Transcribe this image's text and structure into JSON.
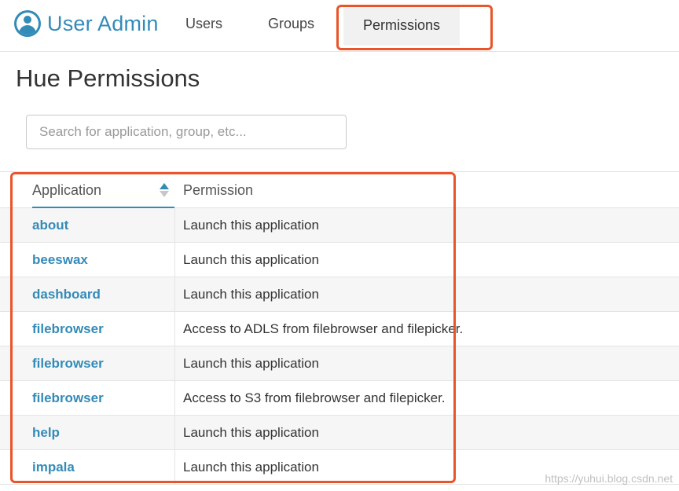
{
  "header": {
    "brand": "User Admin",
    "brand_icon": "user-circle-icon",
    "nav": [
      {
        "label": "Users",
        "active": false
      },
      {
        "label": "Groups",
        "active": false
      },
      {
        "label": "Permissions",
        "active": true
      }
    ]
  },
  "page_title": "Hue Permissions",
  "search": {
    "placeholder": "Search for application, group, etc...",
    "value": ""
  },
  "table": {
    "columns": [
      "Application",
      "Permission"
    ],
    "sort": {
      "column": "Application",
      "direction": "ascending",
      "icon": "sort-arrows-icon"
    },
    "rows": [
      {
        "app": "about",
        "permission": "Launch this application"
      },
      {
        "app": "beeswax",
        "permission": "Launch this application"
      },
      {
        "app": "dashboard",
        "permission": "Launch this application"
      },
      {
        "app": "filebrowser",
        "permission": "Access to ADLS from filebrowser and filepicker."
      },
      {
        "app": "filebrowser",
        "permission": "Launch this application"
      },
      {
        "app": "filebrowser",
        "permission": "Access to S3 from filebrowser and filepicker."
      },
      {
        "app": "help",
        "permission": "Launch this application"
      },
      {
        "app": "impala",
        "permission": "Launch this application"
      }
    ]
  },
  "colors": {
    "accent": "#338bb8",
    "annotation": "#e9552a"
  },
  "watermark": "https://yuhui.blog.csdn.net"
}
